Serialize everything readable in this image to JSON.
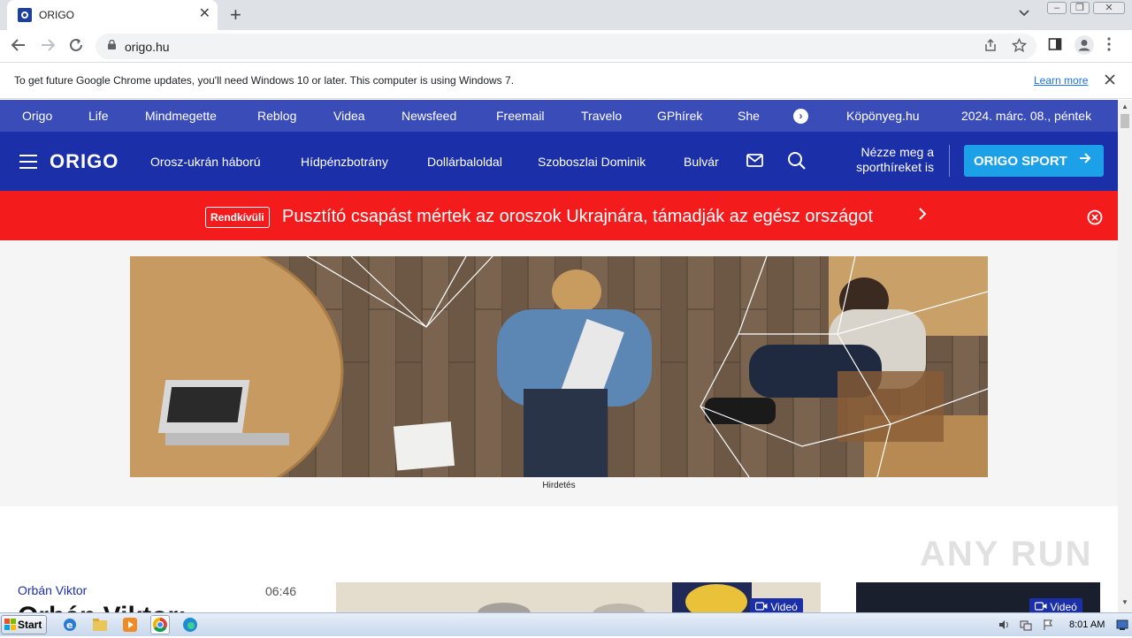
{
  "browser": {
    "tab_title": "ORIGO",
    "tab_close": "✕",
    "new_tab": "+",
    "url": "origo.hu",
    "infobar_text": "To get future Google Chrome updates, you'll need Windows 10 or later. This computer is using Windows 7.",
    "infobar_link": "Learn more"
  },
  "topnav": {
    "items": [
      "Origo",
      "Life",
      "Mindmegette",
      "Reblog",
      "Videa",
      "Newsfeed",
      "Freemail",
      "Travelo",
      "GPhírek",
      "She"
    ],
    "weather": "Köpönyeg.hu",
    "date": "2024. márc. 08., péntek"
  },
  "mainnav": {
    "logo": "ORIGO",
    "items": [
      "Orosz-ukrán háború",
      "Hídpénzbotrány",
      "Dollárbaloldal",
      "Szoboszlai Dominik",
      "Bulvár"
    ],
    "sport_line1": "Nézze meg a",
    "sport_line2": "sporthíreket is",
    "sport_button": "ORIGO SPORT",
    "brand_color": "#1a2fa8",
    "topnav_color": "#3a4cb8",
    "sport_color": "#1ca0e8"
  },
  "breaking": {
    "badge": "Rendkívüli",
    "headline": "Pusztító csapást mértek az oroszok Ukrajnára, támadják az egész országot",
    "color": "#f31b1b"
  },
  "ad": {
    "label": "Hirdetés"
  },
  "article": {
    "category": "Orbán Viktor",
    "time": "06:46",
    "title": "Orbán Viktor:",
    "video_badge_1": "Videó",
    "video_badge_2": "Videó"
  },
  "watermark": "ANY RUN",
  "taskbar": {
    "start": "Start",
    "time": "8:01 AM"
  }
}
